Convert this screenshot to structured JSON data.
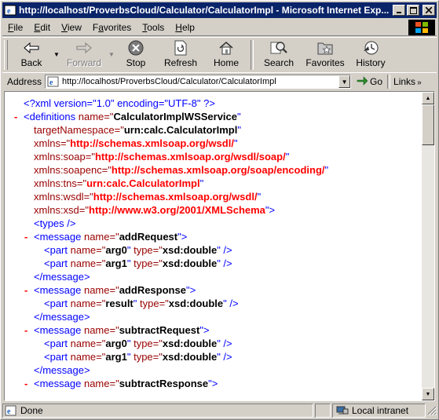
{
  "window": {
    "title": "http://localhost/ProverbsCloud/Calculator/CalculatorImpl - Microsoft Internet Exp..."
  },
  "menu": [
    "File",
    "Edit",
    "View",
    "Favorites",
    "Tools",
    "Help"
  ],
  "menu_underline": [
    "F",
    "E",
    "V",
    "a",
    "T",
    "H"
  ],
  "toolbar": {
    "back": "Back",
    "forward": "Forward",
    "stop": "Stop",
    "refresh": "Refresh",
    "home": "Home",
    "search": "Search",
    "favorites": "Favorites",
    "history": "History"
  },
  "address": {
    "label": "Address",
    "url": "http://localhost/ProverbsCloud/Calculator/CalculatorImpl",
    "go": "Go",
    "links": "Links"
  },
  "xml": {
    "decl": "<?xml version=\"1.0\" encoding=\"UTF-8\" ?>",
    "def_open": "<definitions",
    "def_name_attr": "name=\"",
    "def_name_val": "CalculatorImplWSService",
    "tns_attr": "targetNamespace=\"",
    "tns_val": "urn:calc.CalculatorImpl",
    "xmlns_attr": "xmlns=\"",
    "xmlns_val": "http://schemas.xmlsoap.org/wsdl/",
    "soap_attr": "xmlns:soap=\"",
    "soap_val": "http://schemas.xmlsoap.org/wsdl/soap/",
    "soapenc_attr": "xmlns:soapenc=\"",
    "soapenc_val": "http://schemas.xmlsoap.org/soap/encoding/",
    "tnsns_attr": "xmlns:tns=\"",
    "tnsns_val": "urn:calc.CalculatorImpl",
    "wsdl_attr": "xmlns:wsdl=\"",
    "wsdl_val": "http://schemas.xmlsoap.org/wsdl/",
    "xsd_attr": "xmlns:xsd=\"",
    "xsd_val": "http://www.w3.org/2001/XMLSchema",
    "types": "<types />",
    "msg_open": "<message",
    "msg_close": "</message>",
    "part_open": "<part",
    "name_attr": "name=\"",
    "type_attr": "type=\"",
    "msg1": "addRequest",
    "msg2": "addResponse",
    "msg3": "subtractRequest",
    "msg4": "subtractResponse",
    "arg0": "arg0",
    "arg1": "arg1",
    "result": "result",
    "xsd_double": "xsd:double"
  },
  "status": {
    "text": "Done",
    "zone": "Local intranet"
  }
}
